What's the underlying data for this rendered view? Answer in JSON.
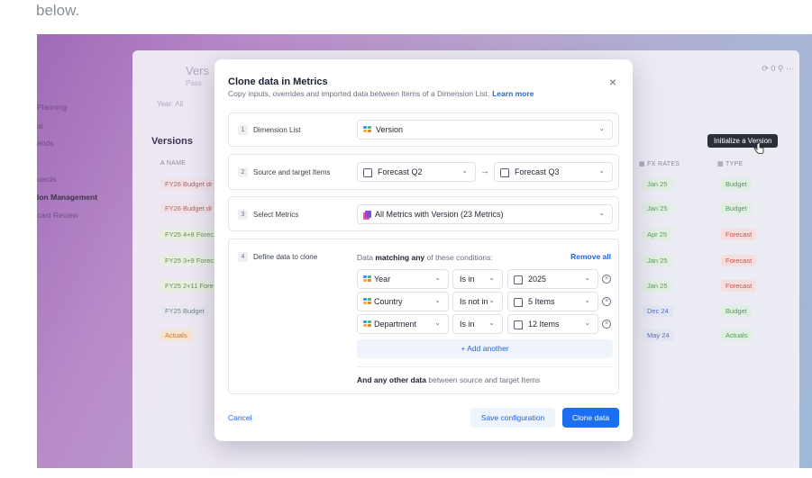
{
  "caption": "below.",
  "background": {
    "sidebar": [
      "Planning",
      "al",
      "ends",
      "oards",
      "ion Management",
      "cast Review"
    ],
    "sidebar_active": "ion Management",
    "blur_title": "Vers",
    "blur_sub": "Pass",
    "blur_year": "Year: All",
    "top_icons": "⟳ 0  ⚲  ···",
    "versions_label": "Versions",
    "col_name": "A  NAME",
    "col_fx": "FX RATES",
    "col_type": "TYPE",
    "rows": [
      {
        "name": "FY26 Budget dr",
        "fx": "Jan 25",
        "type": "Budget"
      },
      {
        "name": "FY26 Budget dr",
        "fx": "Jan 25",
        "type": "Budget"
      },
      {
        "name": "FY25 4+8 Forec",
        "fx": "Apr 25",
        "type": "Forecast"
      },
      {
        "name": "FY25 3+9 Forec",
        "fx": "Jan 25",
        "type": "Forecast"
      },
      {
        "name": "FY25 2+11 Fore",
        "fx": "Jan 25",
        "type": "Forecast"
      },
      {
        "name": "FY25 Budget",
        "fx": "Dec 24",
        "type": "Budget"
      },
      {
        "name": "Actuals",
        "fx": "May 24",
        "type": "Actuals"
      }
    ],
    "tooltip": "Initialize a Version"
  },
  "modal": {
    "title": "Clone data in Metrics",
    "subtitle": "Copy inputs, overrides and imported data between Items of a Dimension List.",
    "learn_more": "Learn more",
    "close_label": "×",
    "steps": [
      {
        "num": "1",
        "label": "Dimension List"
      },
      {
        "num": "2",
        "label": "Source and target Items"
      },
      {
        "num": "3",
        "label": "Select Metrics"
      },
      {
        "num": "4",
        "label": "Define data to clone"
      }
    ],
    "dimension_list": "Version",
    "source_item": "Forecast Q2",
    "target_item": "Forecast Q3",
    "arrow": "→",
    "metrics": "All Metrics with Version (23 Metrics)",
    "conditions_prefix": "Data",
    "conditions_bold": "matching any",
    "conditions_suffix": "of these conditions:",
    "remove_all": "Remove all",
    "conditions": [
      {
        "dimension": "Year",
        "operator": "Is in",
        "value": "2025"
      },
      {
        "dimension": "Country",
        "operator": "Is not in",
        "value": "5 Items"
      },
      {
        "dimension": "Department",
        "operator": "Is in",
        "value": "12 Items"
      }
    ],
    "add_another": "+ Add another",
    "and_any_bold": "And any other data",
    "and_any_rest": "between source and target Items",
    "cancel": "Cancel",
    "save_configuration": "Save configuration",
    "clone_data": "Clone data"
  }
}
